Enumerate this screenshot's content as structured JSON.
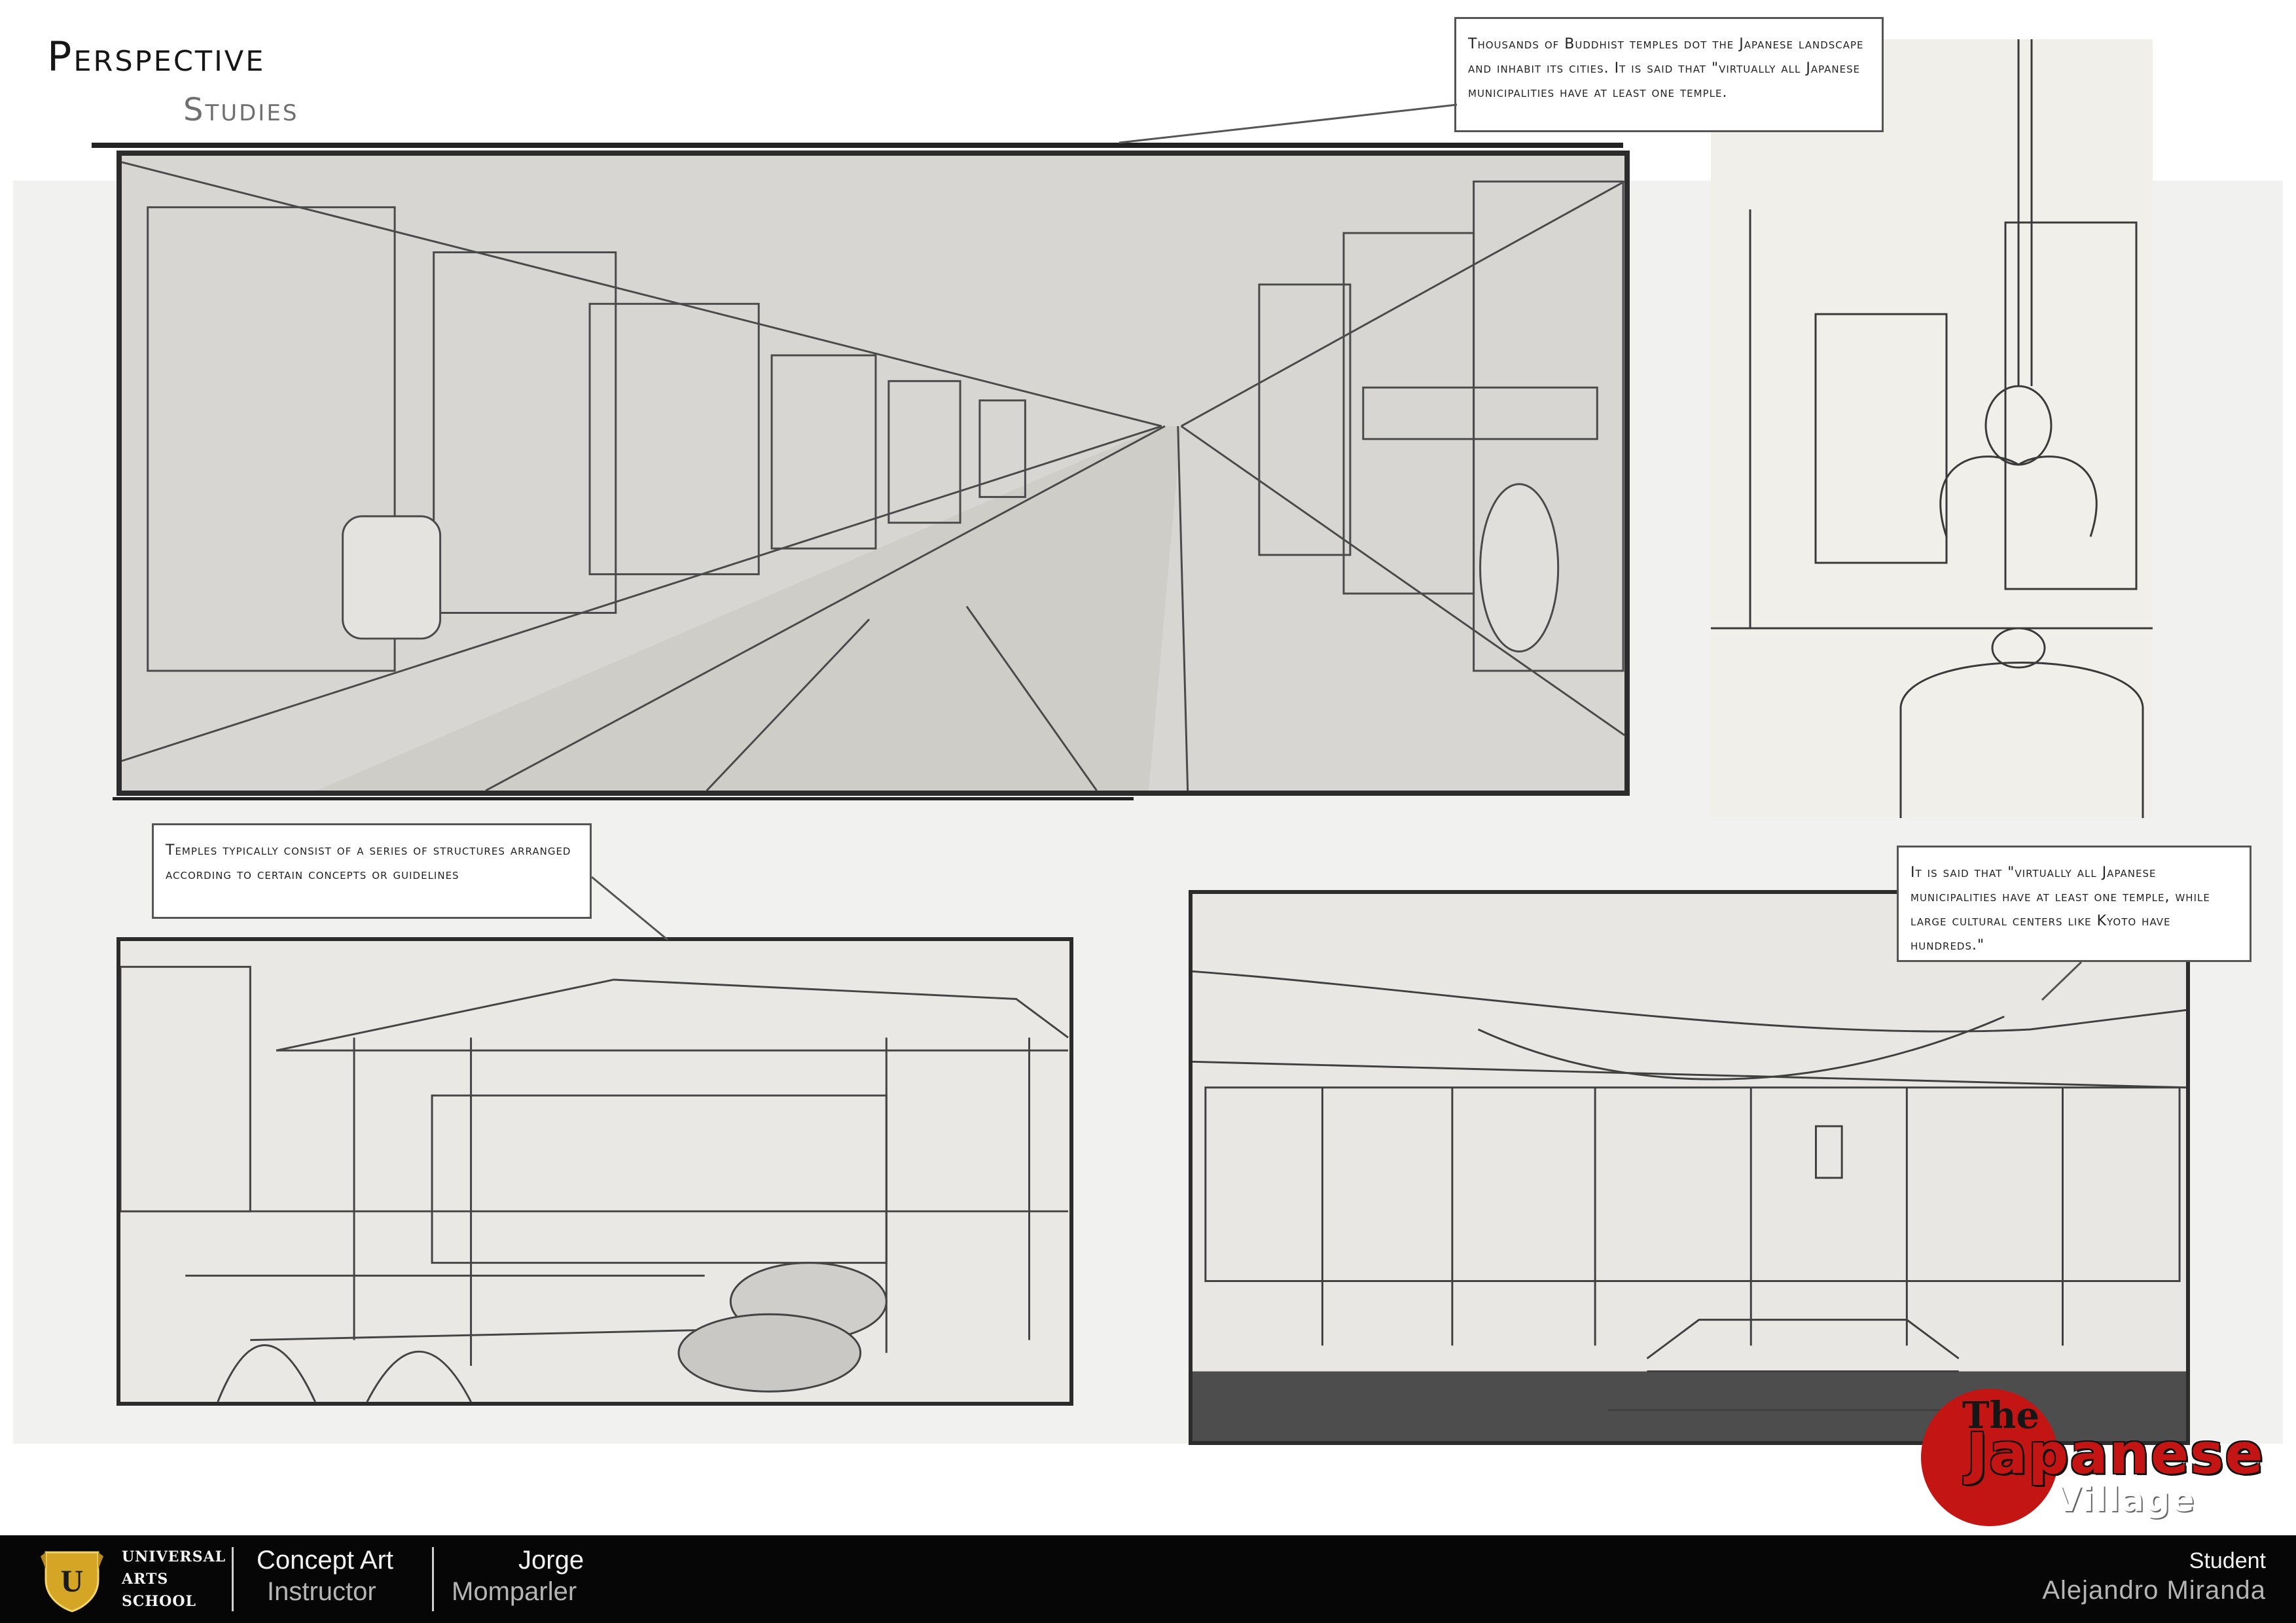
{
  "header": {
    "title": "Perspective",
    "subtitle": "Studies"
  },
  "notes": {
    "top": "Thousands of Buddhist temples dot the Japanese landscape and inhabit its cities. It is said that \"virtually all Japanese municipalities have at least one temple.",
    "left": "Temples typically consist of a series of structures arranged according to certain concepts or guidelines",
    "right": "It is said that \"virtually all Japanese municipalities have at least one temple, while large cultural centers like Kyoto have hundreds.\""
  },
  "logo": {
    "line1": "The",
    "line2": "Japanese",
    "line3": "Village"
  },
  "footer": {
    "school_line1": "UNIVERSAL",
    "school_line2": "ARTS",
    "school_line3": "SCHOOL",
    "course": "Concept Art",
    "instructor_label": "Instructor",
    "instructor_first": "Jorge",
    "instructor_last": "Momparler",
    "student_label": "Student",
    "student_name": "Alejandro Miranda"
  },
  "colors": {
    "accent": "#c41515",
    "footer_bg": "#060606",
    "panel_ink": "#2c2c2c"
  },
  "icons": {
    "school_crest": "shield-crest-icon"
  }
}
